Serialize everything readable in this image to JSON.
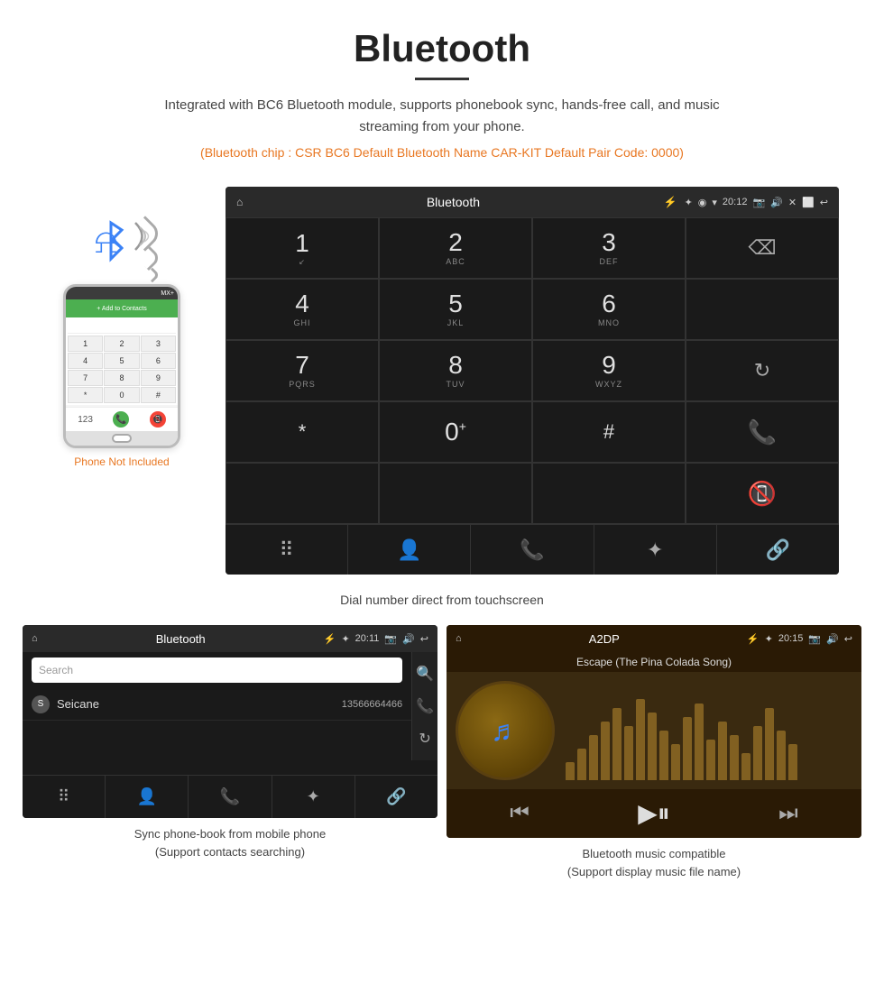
{
  "header": {
    "title": "Bluetooth",
    "subtitle": "Integrated with BC6 Bluetooth module, supports phonebook sync, hands-free call, and music streaming from your phone.",
    "info_line": "(Bluetooth chip : CSR BC6    Default Bluetooth Name CAR-KIT    Default Pair Code: 0000)"
  },
  "car_screen": {
    "status_bar": {
      "home_icon": "⌂",
      "title": "Bluetooth",
      "usb_icon": "⚡",
      "bt_icon": "✦",
      "location_icon": "◉",
      "signal_icon": "▾",
      "time": "20:12",
      "camera_icon": "📷",
      "volume_icon": "🔊",
      "close_icon": "✕",
      "window_icon": "⬜",
      "back_icon": "↩"
    },
    "dialpad": {
      "keys": [
        {
          "num": "1",
          "sub": ""
        },
        {
          "num": "2",
          "sub": "ABC"
        },
        {
          "num": "3",
          "sub": "DEF"
        },
        {
          "num": "",
          "sub": "",
          "type": "backspace"
        },
        {
          "num": "4",
          "sub": "GHI"
        },
        {
          "num": "5",
          "sub": "JKL"
        },
        {
          "num": "6",
          "sub": "MNO"
        },
        {
          "num": "",
          "sub": "",
          "type": "empty"
        },
        {
          "num": "7",
          "sub": "PQRS"
        },
        {
          "num": "8",
          "sub": "TUV"
        },
        {
          "num": "9",
          "sub": "WXYZ"
        },
        {
          "num": "",
          "sub": "",
          "type": "refresh"
        },
        {
          "num": "*",
          "sub": ""
        },
        {
          "num": "0",
          "sub": "+"
        },
        {
          "num": "#",
          "sub": ""
        },
        {
          "num": "",
          "sub": "",
          "type": "call-green"
        },
        {
          "num": "",
          "sub": "",
          "type": "empty2"
        },
        {
          "num": "",
          "sub": "",
          "type": "empty3"
        },
        {
          "num": "",
          "sub": "",
          "type": "empty4"
        },
        {
          "num": "",
          "sub": "",
          "type": "call-red"
        }
      ]
    },
    "bottom_nav": [
      "⠿",
      "👤",
      "📞",
      "✦",
      "🔗"
    ]
  },
  "dial_note": "Dial number direct from touchscreen",
  "phone_mockup": {
    "not_included": "Phone Not Included",
    "status": "MX+",
    "header": "+ Add to Contacts",
    "keys": [
      "1",
      "2",
      "3",
      "4",
      "5",
      "6",
      "7",
      "8",
      "9",
      "*",
      "0",
      "#"
    ]
  },
  "phonebook_screen": {
    "status_bar": {
      "home_icon": "⌂",
      "title": "Bluetooth",
      "usb_icon": "⚡",
      "bt_icon": "✦",
      "time": "20:11",
      "camera_icon": "📷",
      "volume_icon": "🔊",
      "back_icon": "↩"
    },
    "search_placeholder": "Search",
    "contacts": [
      {
        "letter": "S",
        "name": "Seicane",
        "number": "13566664466"
      }
    ],
    "right_icons": [
      "🔍",
      "📞",
      "↻"
    ],
    "bottom_nav": [
      "⠿",
      "👤",
      "📞",
      "✦",
      "🔗"
    ]
  },
  "phonebook_caption": "Sync phone-book from mobile phone\n(Support contacts searching)",
  "music_screen": {
    "status_bar": {
      "home_icon": "⌂",
      "title": "A2DP",
      "usb_icon": "⚡",
      "bt_icon": "✦",
      "time": "20:15",
      "camera_icon": "📷",
      "volume_icon": "🔊",
      "back_icon": "↩"
    },
    "song_title": "Escape (The Pina Colada Song)",
    "visualizer_bars": [
      20,
      35,
      50,
      65,
      80,
      60,
      90,
      75,
      55,
      40,
      70,
      85,
      45,
      65,
      50,
      30,
      60,
      80,
      55,
      40
    ],
    "controls": [
      "⏮",
      "▶⏸",
      "⏭"
    ]
  },
  "music_caption": "Bluetooth music compatible\n(Support display music file name)"
}
